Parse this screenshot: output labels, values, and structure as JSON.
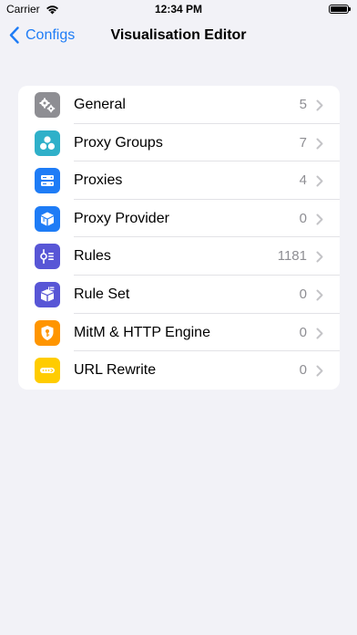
{
  "status_bar": {
    "carrier": "Carrier",
    "time": "12:34 PM"
  },
  "nav": {
    "back_label": "Configs",
    "title": "Visualisation Editor"
  },
  "colors": {
    "accent": "#1e7cf6",
    "background": "#f2f2f7"
  },
  "items": [
    {
      "label": "General",
      "count": "5",
      "icon": "gears-icon",
      "color": "#8e8e93"
    },
    {
      "label": "Proxy Groups",
      "count": "7",
      "icon": "circles-group-icon",
      "color": "#2fb0c9"
    },
    {
      "label": "Proxies",
      "count": "4",
      "icon": "server-icon",
      "color": "#1e7cf6"
    },
    {
      "label": "Proxy Provider",
      "count": "0",
      "icon": "box-provider-icon",
      "color": "#1e7cf6"
    },
    {
      "label": "Rules",
      "count": "1181",
      "icon": "rules-icon",
      "color": "#5856d6"
    },
    {
      "label": "Rule Set",
      "count": "0",
      "icon": "rule-set-icon",
      "color": "#5856d6"
    },
    {
      "label": "MitM & HTTP Engine",
      "count": "0",
      "icon": "shield-key-icon",
      "color": "#ff9500"
    },
    {
      "label": "URL Rewrite",
      "count": "0",
      "icon": "url-rewrite-icon",
      "color": "#ffcc00"
    }
  ]
}
